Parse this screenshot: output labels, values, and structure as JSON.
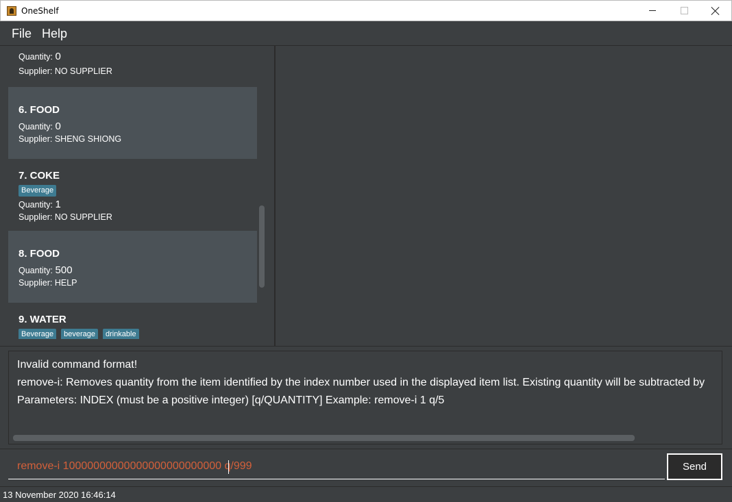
{
  "window": {
    "title": "OneShelf",
    "icon": "oneshelf-app-icon",
    "controls": [
      "minimize-icon",
      "maximize-icon",
      "close-icon"
    ]
  },
  "menu": {
    "file": "File",
    "help": "Help"
  },
  "labels": {
    "quantity": "Quantity:",
    "supplier": "Supplier:"
  },
  "items": [
    {
      "title": "",
      "tags": [],
      "quantity": "0",
      "supplier": "NO SUPPLIER"
    },
    {
      "title": "6.  FOOD",
      "tags": [],
      "quantity": "0",
      "supplier": "SHENG SHIONG"
    },
    {
      "title": "7.  COKE",
      "tags": [
        "Beverage"
      ],
      "quantity": "1",
      "supplier": "NO SUPPLIER"
    },
    {
      "title": "8.  FOOD",
      "tags": [],
      "quantity": "500",
      "supplier": "HELP"
    },
    {
      "title": "9.  WATER",
      "tags": [
        "Beverage",
        "beverage",
        "drinkable"
      ]
    }
  ],
  "result": {
    "lines": [
      "Invalid command format!",
      "remove-i: Removes quantity from the item identified by the index number used in the displayed item list. Existing quantity will be subtracted by",
      "Parameters: INDEX (must be a positive integer) [q/QUANTITY] Example: remove-i 1 q/5"
    ]
  },
  "command": {
    "value": "remove-i 10000000000000000000000000 q/999",
    "send_label": "Send"
  },
  "status": {
    "datetime": "13 November 2020 16:46:14"
  },
  "colors": {
    "background": "#3c3f41",
    "card_highlight": "#4b5257",
    "tag": "#3e7b91",
    "error_text": "#d4603a"
  }
}
